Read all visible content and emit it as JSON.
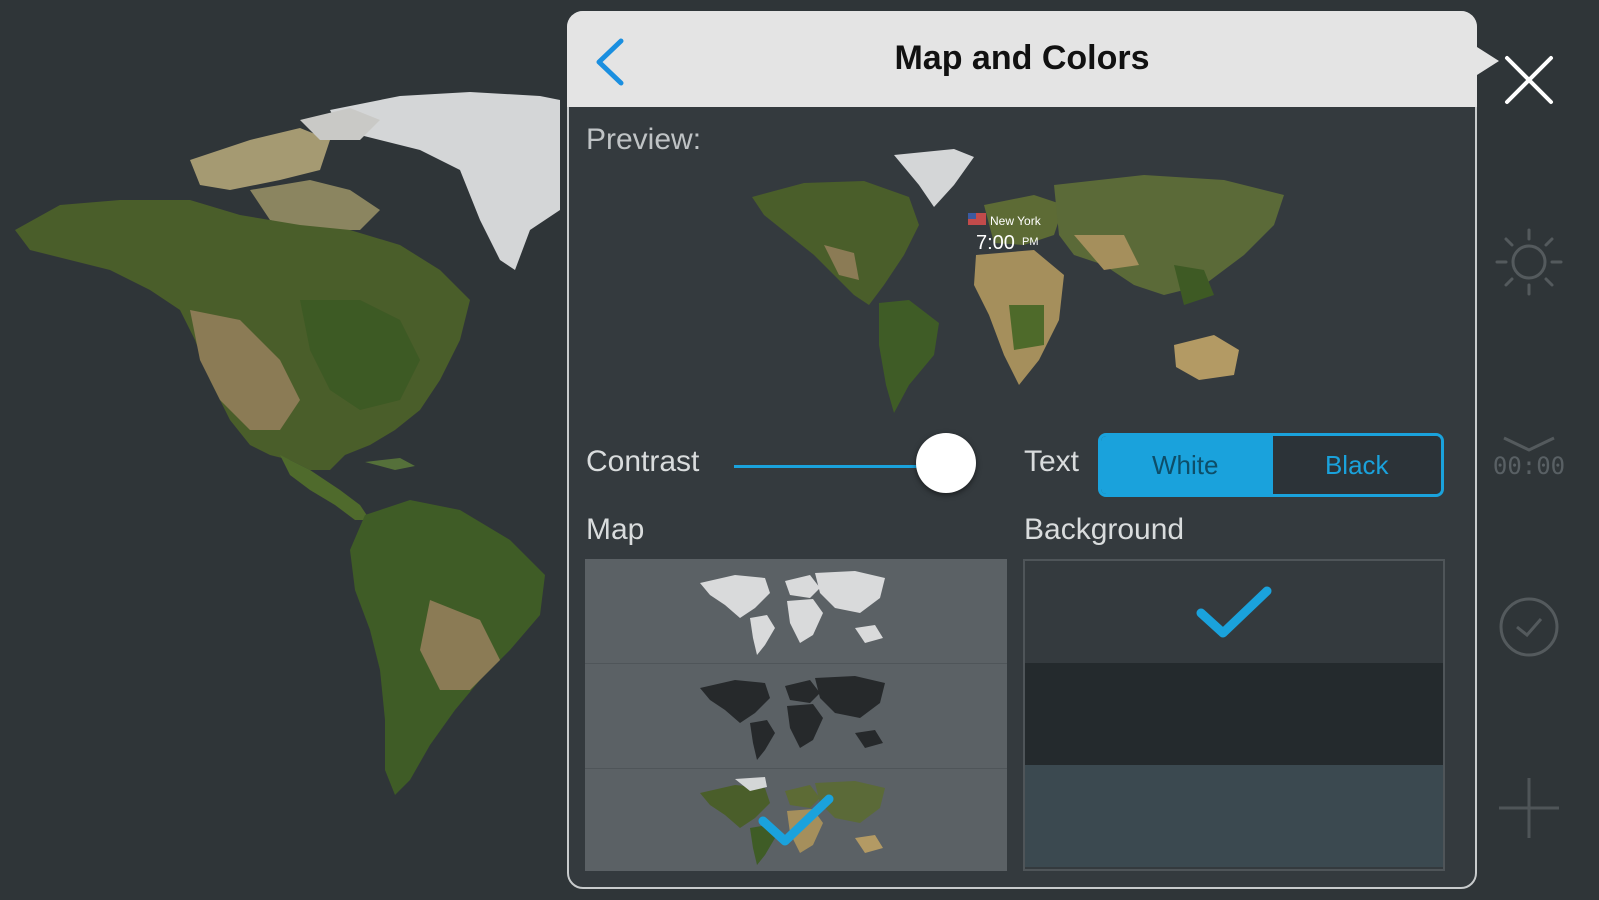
{
  "panel": {
    "title": "Map and Colors",
    "preview_label": "Preview:",
    "preview_city": "New York",
    "preview_time": "7:00",
    "preview_ampm": "PM",
    "contrast_label": "Contrast",
    "contrast_value": 0.92,
    "text_label": "Text",
    "text_options": [
      "White",
      "Black"
    ],
    "text_selected": "White",
    "map_label": "Map",
    "map_options": [
      "light-map",
      "dark-map",
      "satellite-map"
    ],
    "map_selected": "satellite-map",
    "background_label": "Background",
    "background_options": [
      "#343a3e",
      "#242a2d",
      "#3b4950"
    ],
    "background_selected": 0
  },
  "toolbar": {
    "icons": [
      "close-icon",
      "brightness-icon",
      "alarm-icon",
      "timer-icon",
      "add-icon"
    ],
    "alarm_time": "00:00"
  },
  "colors": {
    "accent": "#1aa2dc",
    "background": "#2f3538",
    "header": "#e4e4e4"
  }
}
